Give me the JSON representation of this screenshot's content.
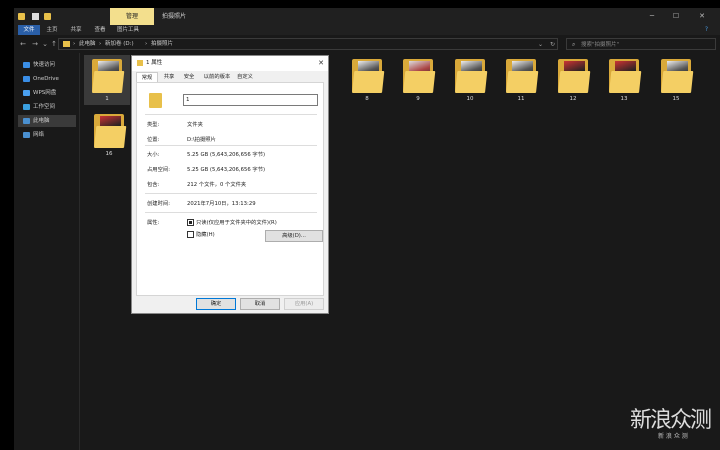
{
  "window": {
    "contextual_tab": "管理",
    "title": "拍摄照片",
    "minimize": "─",
    "maximize": "☐",
    "close": "✕"
  },
  "ribbon": {
    "tabs": [
      "文件",
      "主页",
      "共享",
      "查看",
      "图片工具"
    ],
    "help": "?"
  },
  "address": {
    "back": "←",
    "forward": "→",
    "dropdown": "⌄",
    "up": "↑",
    "crumbs": [
      "此电脑",
      "新加卷 (D:)",
      "拍摄照片"
    ],
    "separators": "›",
    "addr_dropdown": "⌄",
    "refresh": "↻",
    "search_placeholder": "搜索\"拍摄照片\"",
    "search_icon": "⌕"
  },
  "nav": {
    "items": [
      {
        "label": "快速访问",
        "icon": "star-icon",
        "color": "#3a8ee6"
      },
      {
        "label": "OneDrive",
        "icon": "cloud-icon",
        "color": "#3a8ee6"
      },
      {
        "label": "WPS网盘",
        "icon": "cloud-icon",
        "color": "#4aa0f0"
      },
      {
        "label": "工作空间",
        "icon": "workspace-icon",
        "color": "#3aa0e0"
      },
      {
        "label": "此电脑",
        "icon": "computer-icon",
        "color": "#4a90d0"
      },
      {
        "label": "网络",
        "icon": "network-icon",
        "color": "#4a90d0"
      }
    ]
  },
  "folders": {
    "row1": [
      "1",
      "8",
      "9",
      "10",
      "11",
      "12",
      "13",
      "15"
    ],
    "row2": [
      "16"
    ]
  },
  "dialog": {
    "title": "1 属性",
    "close": "✕",
    "tabs": [
      "常规",
      "共享",
      "安全",
      "以前的版本",
      "自定义"
    ],
    "name_value": "1",
    "rows": {
      "type_label": "类型:",
      "type_value": "文件夹",
      "location_label": "位置:",
      "location_value": "D:\\拍摄照片",
      "size_label": "大小:",
      "size_value": "5.25 GB (5,643,206,656 字节)",
      "disk_label": "占用空间:",
      "disk_value": "5.25 GB (5,643,206,656 字节)",
      "contains_label": "包含:",
      "contains_value": "212 个文件，0 个文件夹",
      "created_label": "创建时间:",
      "created_value": "2021年7月10日，13:13:29",
      "attrs_label": "属性:",
      "readonly_label": "只读(仅应用于文件夹中的文件)(R)",
      "hidden_label": "隐藏(H)",
      "advanced": "高级(D)..."
    },
    "buttons": {
      "ok": "确定",
      "cancel": "取消",
      "apply": "应用(A)"
    }
  },
  "watermark": {
    "text": "新浪众测",
    "sub": "新 浪 众 测"
  }
}
